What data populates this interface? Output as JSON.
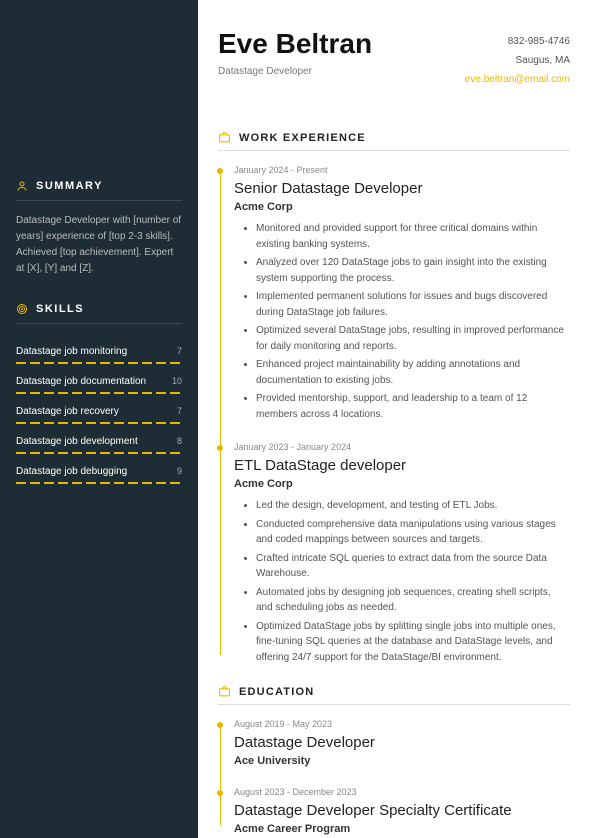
{
  "header": {
    "name": "Eve Beltran",
    "role": "Datastage Developer",
    "phone": "832-985-4746",
    "location": "Saugus, MA",
    "email": "eve.beltran@email.com"
  },
  "summary": {
    "heading": "SUMMARY",
    "text": "Datastage Developer with [number of years] experience of [top 2-3 skills]. Achieved [top achievement]. Expert at [X], [Y] and [Z]."
  },
  "skills": {
    "heading": "SKILLS",
    "items": [
      {
        "label": "Datastage job monitoring",
        "score": "7"
      },
      {
        "label": "Datastage job documentation",
        "score": "10"
      },
      {
        "label": "Datastage job recovery",
        "score": "7"
      },
      {
        "label": "Datastage job development",
        "score": "8"
      },
      {
        "label": "Datastage job debugging",
        "score": "9"
      }
    ]
  },
  "work": {
    "heading": "WORK EXPERIENCE",
    "items": [
      {
        "dates": "January 2024 - Present",
        "title": "Senior Datastage Developer",
        "company": "Acme Corp",
        "bullets": [
          "Monitored and provided support for three critical domains within existing banking systems.",
          "Analyzed over 120 DataStage jobs to gain insight into the existing system supporting the process.",
          "Implemented permanent solutions for issues and bugs discovered during DataStage job failures.",
          "Optimized several DataStage jobs, resulting in improved performance for daily monitoring and reports.",
          "Enhanced project maintainability by adding annotations and documentation to existing jobs.",
          "Provided mentorship, support, and leadership to a team of 12 members across 4 locations."
        ]
      },
      {
        "dates": "January 2023 - January 2024",
        "title": "ETL DataStage developer",
        "company": "Acme Corp",
        "bullets": [
          "Led the design, development, and testing of ETL Jobs.",
          "Conducted comprehensive data manipulations using various stages and coded mappings between sources and targets.",
          "Crafted intricate SQL queries to extract data from the source Data Warehouse.",
          "Automated jobs by designing job sequences, creating shell scripts, and scheduling jobs as needed.",
          "Optimized DataStage jobs by splitting single jobs into multiple ones, fine-tuning SQL queries at the database and DataStage levels, and offering 24/7 support for the DataStage/BI environment."
        ]
      }
    ]
  },
  "education": {
    "heading": "EDUCATION",
    "items": [
      {
        "dates": "August 2019 - May 2023",
        "title": "Datastage Developer",
        "company": "Ace University"
      },
      {
        "dates": "August 2023 - December 2023",
        "title": "Datastage Developer Specialty Certificate",
        "company": "Acme Career Program"
      }
    ]
  }
}
